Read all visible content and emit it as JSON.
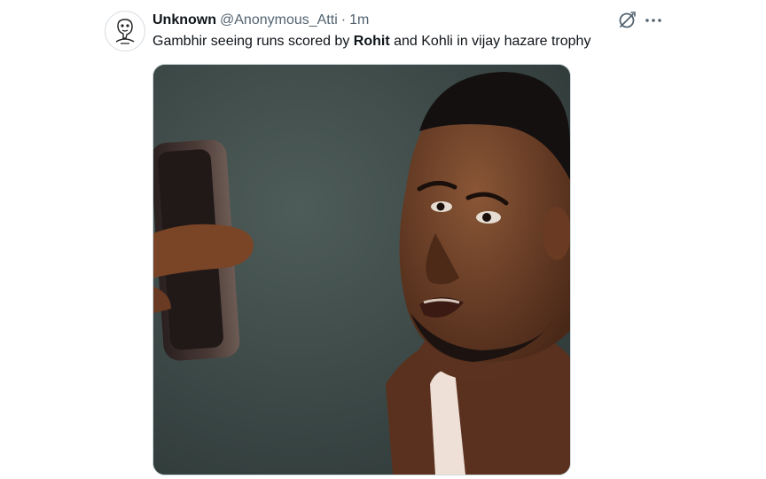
{
  "author": {
    "display_name": "Unknown",
    "handle": "@Anonymous_Atti",
    "separator": "·",
    "timestamp": "1m"
  },
  "tweet": {
    "text_before": "Gambhir seeing runs scored by ",
    "bold_word": "Rohit",
    "text_after": " and Kohli in vijay hazare trophy"
  },
  "icons": {
    "grok": "grok-icon",
    "more": "more-options-icon",
    "avatar": "avatar-sketch"
  },
  "colors": {
    "text_primary": "#0f1419",
    "text_secondary": "#536471",
    "border": "#cfd9de",
    "media_background": "#3d4a48"
  }
}
